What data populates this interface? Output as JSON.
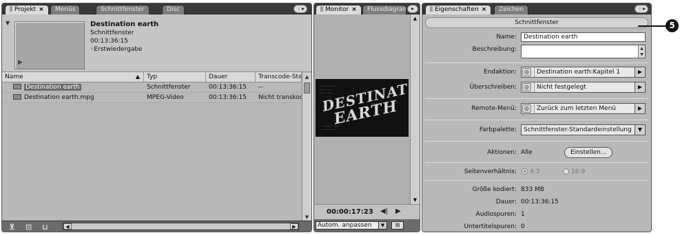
{
  "project": {
    "tabs": [
      {
        "label": "Projekt",
        "close": "×"
      },
      {
        "label": "Menüs"
      },
      {
        "label": "Schnittfenster"
      },
      {
        "label": "Disc"
      }
    ],
    "asset": {
      "title": "Destination earth",
      "type": "Schnittfenster",
      "duration": "00:13:36:15",
      "first_play": "Erstwiedergabe"
    },
    "columns": [
      "Name",
      "Typ",
      "Dauer",
      "Transcode-Status"
    ],
    "rows": [
      {
        "name": "Destination earth",
        "type": "Schnittfenster",
        "duration": "00:13:36:15",
        "status": "--"
      },
      {
        "name": "Destination earth.mpg",
        "type": "MPEG-Video",
        "duration": "00:13:36:15",
        "status": "Nicht transkodiert"
      }
    ],
    "footer_icons": [
      "filter-icon",
      "new-item-icon",
      "trash-icon"
    ]
  },
  "monitor": {
    "tabs": [
      {
        "label": "Monitor",
        "close": "×"
      },
      {
        "label": "Flussdiagramm"
      }
    ],
    "timecode": "00:00:17:23",
    "zoom": "Autom. anpassen"
  },
  "properties": {
    "tabs": [
      {
        "label": "Eigenschaften",
        "close": "×"
      },
      {
        "label": "Zeichen"
      }
    ],
    "header": "Schnittfenster",
    "name_label": "Name:",
    "name_value": "Destination earth",
    "desc_label": "Beschreibung:",
    "end_action_label": "Endaktion:",
    "end_action_value": "Destination earth:Kapitel 1",
    "override_label": "Überschreiben:",
    "override_value": "Nicht festgelegt",
    "remote_label": "Remote-Menü:",
    "remote_value": "Zurück zum letzten Menü",
    "palette_label": "Farbpalette:",
    "palette_value": "Schnittfenster-Standardeinstellung",
    "actions_label": "Aktionen:",
    "actions_value": "Alle",
    "actions_button": "Einstellen...",
    "aspect_label": "Seitenverhältnis:",
    "aspect_4_3": "4:3",
    "aspect_16_9": "16:9",
    "size_label": "Größe kodiert:",
    "size_value": "833 MB",
    "duration_label": "Dauer:",
    "duration_value": "00:13:36:15",
    "audio_label": "Audiospuren:",
    "audio_value": "1",
    "subs_label": "Untertitelspuren:",
    "subs_value": "0"
  },
  "callout": "5"
}
